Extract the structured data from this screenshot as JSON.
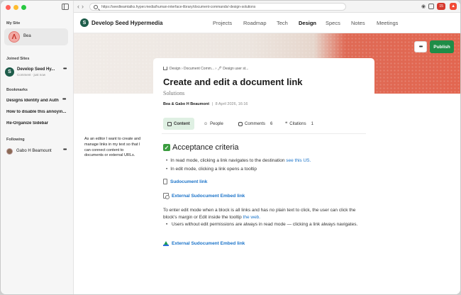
{
  "browser": {
    "url": "https://seedteamtalks.hyper.media/human-interface-library/document-commands/-design-solutions",
    "notification_count": "15"
  },
  "sidebar": {
    "my_site_label": "My Site",
    "my_site_name": "Bea",
    "joined_sites_label": "Joined Sites",
    "joined_site": {
      "name": "Develop Seed Hy...",
      "meta": "Comment · just now"
    },
    "bookmarks_label": "Bookmarks",
    "bookmarks": [
      "Designs Identity and Auth",
      "How to disable this annoyin...",
      "Re-Organize Sidebar"
    ],
    "following_label": "Following",
    "following": [
      {
        "name": "Gabo H Beamount"
      }
    ]
  },
  "header": {
    "site_title": "Develop Seed Hypermedia",
    "nav": [
      "Projects",
      "Roadmap",
      "Tech",
      "Design",
      "Specs",
      "Notes",
      "Meetings"
    ],
    "active_nav": "Design"
  },
  "actions": {
    "publish_label": "Publish"
  },
  "document": {
    "breadcrumb": "Design › Document Comm... › 🖊 Design user st...",
    "title": "Create and edit a document link",
    "subtitle": "Solutions",
    "authors": "Bea & Gabo H Beaumont",
    "date": "8 April 2026, 16:16",
    "tabs": [
      {
        "label": "Content",
        "count": ""
      },
      {
        "label": "People",
        "count": ""
      },
      {
        "label": "Comments",
        "count": "6"
      },
      {
        "label": "Citations",
        "count": "1"
      }
    ],
    "heading": "Acceptance criteria",
    "bullets": [
      {
        "text": "In read mode, clicking a link navigates to the destination ",
        "link": "see this US."
      },
      {
        "text": "In edit mode, clicking a link opens a tooltip",
        "link": ""
      }
    ],
    "link1": "Sudocument link",
    "link2": "External Sudocument Embed link",
    "paragraph_text": "To enter edit mode when a block is all links and has no plain text to click, the user can click the block's margin or Edit inside the tooltip ",
    "paragraph_link": "the web.",
    "bullet3": "Users without edit permissions are always in read mode — clicking a link always navigates.",
    "link3": "External Sudocument Embed link"
  },
  "side_note": "As an editor I want to create and manage links in my text so that I can connect content to documents or external URLs."
}
